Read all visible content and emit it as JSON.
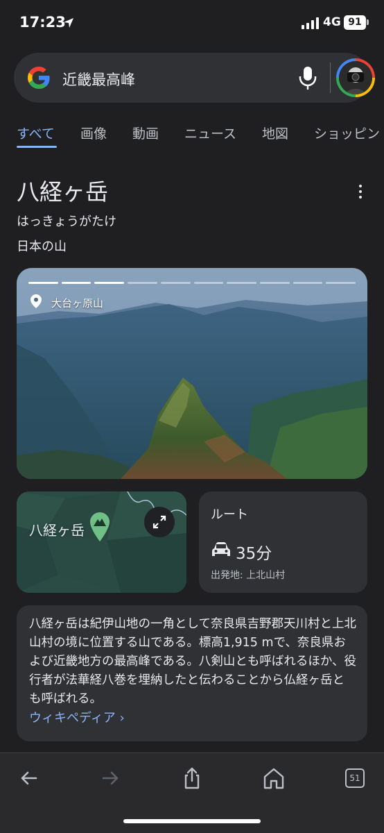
{
  "status_bar": {
    "time": "17:23",
    "network": "4G",
    "battery": "91"
  },
  "search": {
    "query": "近畿最高峰"
  },
  "tabs": [
    {
      "label": "すべて",
      "active": true
    },
    {
      "label": "画像"
    },
    {
      "label": "動画"
    },
    {
      "label": "ニュース"
    },
    {
      "label": "地図"
    },
    {
      "label": "ショッピン"
    }
  ],
  "knowledge_panel": {
    "title": "八経ヶ岳",
    "reading": "はっきょうがたけ",
    "subtitle": "日本の山",
    "image": {
      "location_label": "大台ヶ原山",
      "slides_total": 10,
      "slides_viewed": 3
    },
    "map": {
      "label": "八経ヶ岳"
    },
    "route": {
      "title": "ルート",
      "duration": "35分",
      "origin": "出発地: 上北山村"
    },
    "description": "八経ヶ岳は紀伊山地の一角として奈良県吉野郡天川村と上北山村の境に位置する山である。標高1,915 mで、奈良県および近畿地方の最高峰である。八剣山とも呼ばれるほか、役行者が法華経八巻を埋納したと伝わることから仏経ヶ岳とも呼ばれる。",
    "source_link": "ウィキペディア ›"
  },
  "toolbar": {
    "tab_count": "51"
  },
  "colors": {
    "background": "#1f1f22",
    "card": "#303134",
    "accent": "#8ab4f8"
  },
  "icons": [
    "location-arrow-icon",
    "signal-icon",
    "google-logo-icon",
    "mic-icon",
    "more-vert-icon",
    "location-pin-icon",
    "mountain-pin-icon",
    "expand-icon",
    "car-icon",
    "back-icon",
    "forward-icon",
    "share-icon",
    "home-icon",
    "tabs-icon"
  ]
}
